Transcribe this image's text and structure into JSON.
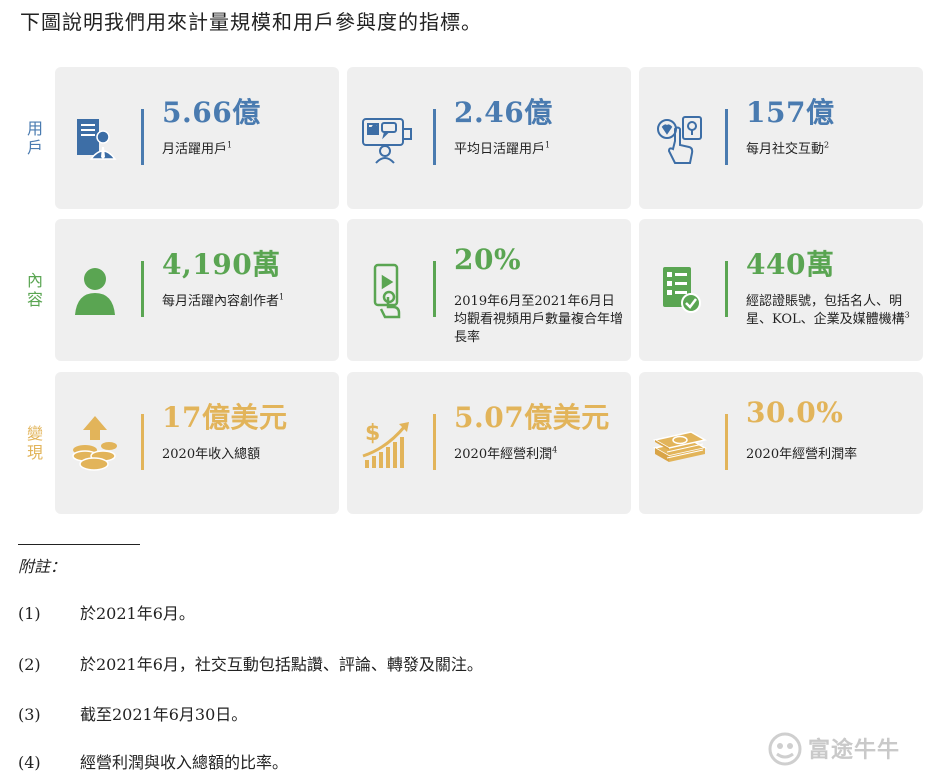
{
  "intro": "下圖說明我們用來計量規模和用戶參與度的指標。",
  "rows": {
    "users": {
      "label": "用戶",
      "color": "#4a7bb0"
    },
    "content": {
      "label": "內容",
      "color": "#5aa552"
    },
    "monetization": {
      "label": "變現",
      "color": "#e2b45a"
    }
  },
  "cards": {
    "mau": {
      "value": "5.66億",
      "desc": "月活躍用戶",
      "sup": "1",
      "icon": "user-computer-icon"
    },
    "dau": {
      "value": "2.46億",
      "desc": "平均日活躍用戶",
      "sup": "1",
      "icon": "social-screen-icon"
    },
    "social": {
      "value": "157億",
      "desc": "每月社交互動",
      "sup": "2",
      "icon": "tap-like-icon"
    },
    "creators": {
      "value": "4,190萬",
      "desc": "每月活躍內容創作者",
      "sup": "1",
      "icon": "person-silhouette-icon"
    },
    "video": {
      "value": "20%",
      "desc": "2019年6月至2021年6月日均觀看視頻用戶數量複合年增長率",
      "sup": "",
      "icon": "phone-video-icon"
    },
    "verified": {
      "value": "440萬",
      "desc": "經認證賬號，包括名人、明星、KOL、企業及媒體機構",
      "sup": "3",
      "icon": "checklist-icon"
    },
    "revenue": {
      "value": "17億美元",
      "desc": "2020年收入總額",
      "sup": "",
      "icon": "coins-arrow-icon"
    },
    "op_income": {
      "value": "5.07億美元",
      "desc": "2020年經營利潤",
      "sup": "4",
      "icon": "dollar-growth-icon"
    },
    "op_margin": {
      "value": "30.0%",
      "desc": "2020年經營利潤率",
      "sup": "",
      "icon": "cash-stack-icon"
    }
  },
  "notes": {
    "title": "附註：",
    "items": [
      {
        "num": "(1)",
        "text": "於2021年6月。"
      },
      {
        "num": "(2)",
        "text": "於2021年6月，社交互動包括點讚、評論、轉發及關注。"
      },
      {
        "num": "(3)",
        "text": "截至2021年6月30日。"
      },
      {
        "num": "(4)",
        "text": "經營利潤與收入總額的比率。"
      }
    ]
  },
  "watermark": "富途牛牛"
}
